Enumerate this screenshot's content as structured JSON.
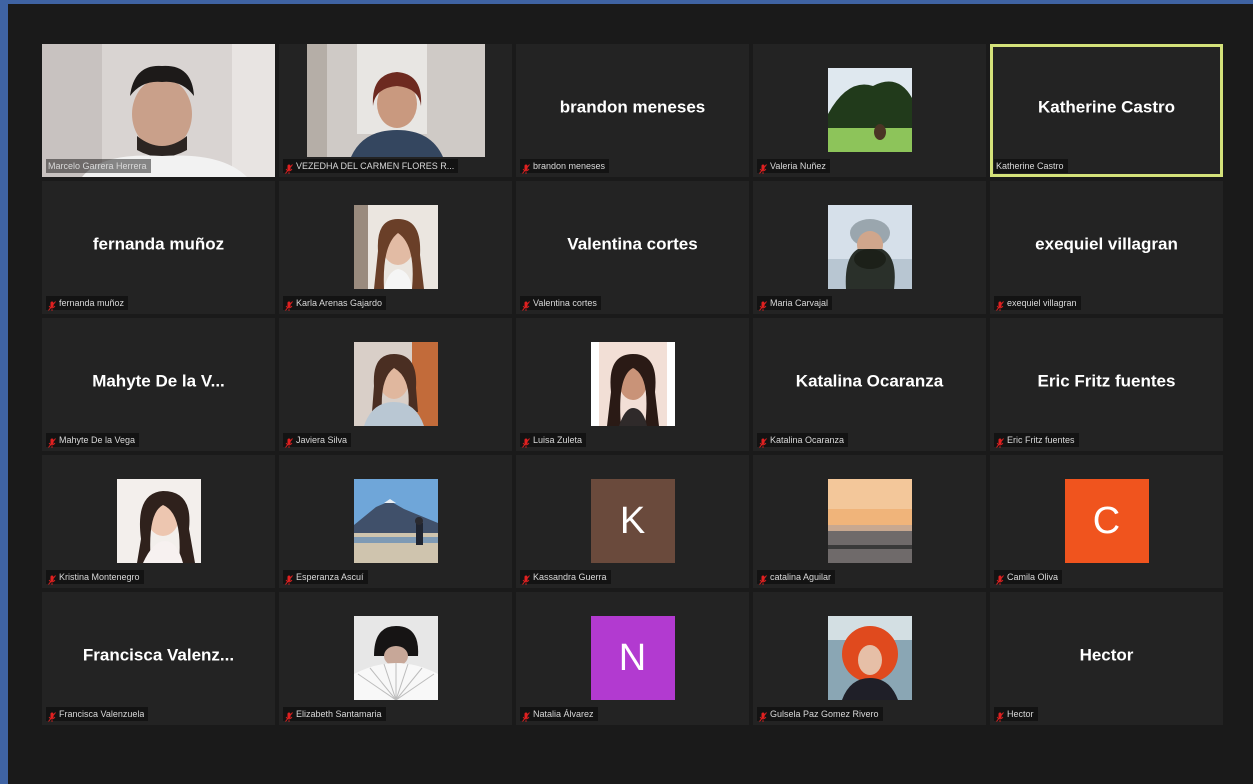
{
  "gallery": {
    "tiles": [
      {
        "label": "Marcelo Garrera Herrera",
        "display": "",
        "thumb": "video-man",
        "muted": false,
        "active": false
      },
      {
        "label": "VEZEDHA DEL CARMEN FLORES R...",
        "display": "",
        "thumb": "video-woman",
        "muted": true,
        "active": false
      },
      {
        "label": "brandon meneses",
        "display": "brandon meneses",
        "thumb": "",
        "muted": true,
        "active": false
      },
      {
        "label": "Valeria Nuñez",
        "display": "",
        "thumb": "photo-garden",
        "muted": true,
        "active": false
      },
      {
        "label": "Katherine Castro",
        "display": "Katherine Castro",
        "thumb": "",
        "muted": false,
        "active": true
      },
      {
        "label": "fernanda muñoz",
        "display": "fernanda muñoz",
        "thumb": "",
        "muted": true,
        "active": false
      },
      {
        "label": "Karla Arenas Gajardo",
        "display": "",
        "thumb": "photo-portrait-a",
        "muted": true,
        "active": false
      },
      {
        "label": "Valentina cortes",
        "display": "Valentina cortes",
        "thumb": "",
        "muted": true,
        "active": false
      },
      {
        "label": "Maria Carvajal",
        "display": "",
        "thumb": "photo-winter",
        "muted": true,
        "active": false
      },
      {
        "label": "exequiel villagran",
        "display": "exequiel villagran",
        "thumb": "",
        "muted": true,
        "active": false
      },
      {
        "label": "Mahyte De la Vega",
        "display": "Mahyte De la V...",
        "thumb": "",
        "muted": true,
        "active": false
      },
      {
        "label": "Javiera Silva",
        "display": "",
        "thumb": "photo-portrait-b",
        "muted": true,
        "active": false
      },
      {
        "label": "Luisa Zuleta",
        "display": "",
        "thumb": "photo-portrait-c",
        "muted": true,
        "active": false
      },
      {
        "label": "Katalina Ocaranza",
        "display": "Katalina Ocaranza",
        "thumb": "",
        "muted": true,
        "active": false
      },
      {
        "label": "Eric Fritz fuentes",
        "display": "Eric Fritz fuentes",
        "thumb": "",
        "muted": true,
        "active": false
      },
      {
        "label": "Kristina Montenegro",
        "display": "",
        "thumb": "photo-portrait-d",
        "muted": true,
        "active": false
      },
      {
        "label": "Esperanza Ascuí",
        "display": "",
        "thumb": "photo-volcano",
        "muted": true,
        "active": false
      },
      {
        "label": "Kassandra Guerra",
        "display": "",
        "thumb": "letter-K",
        "muted": true,
        "active": false
      },
      {
        "label": "catalina Aguilar",
        "display": "",
        "thumb": "photo-sunset",
        "muted": true,
        "active": false
      },
      {
        "label": "Camila Oliva",
        "display": "",
        "thumb": "letter-C",
        "muted": true,
        "active": false
      },
      {
        "label": "Francisca Valenzuela",
        "display": "Francisca  Valenz...",
        "thumb": "",
        "muted": true,
        "active": false
      },
      {
        "label": "Elizabeth Santamaria",
        "display": "",
        "thumb": "photo-fan",
        "muted": true,
        "active": false
      },
      {
        "label": "Natalia Álvarez",
        "display": "",
        "thumb": "letter-N",
        "muted": true,
        "active": false
      },
      {
        "label": "Gulsela Paz Gomez Rivero",
        "display": "",
        "thumb": "photo-redhair",
        "muted": true,
        "active": false
      },
      {
        "label": "Hector",
        "display": "Hector",
        "thumb": "",
        "muted": true,
        "active": false
      }
    ]
  },
  "letters": {
    "K": "K",
    "C": "C",
    "N": "N"
  },
  "colors": {
    "letter-K": "#6a4a3c",
    "letter-C": "#f0541e",
    "letter-N": "#b23ad0",
    "active_border": "#d4e27a",
    "mic_muted": "#e02020"
  }
}
